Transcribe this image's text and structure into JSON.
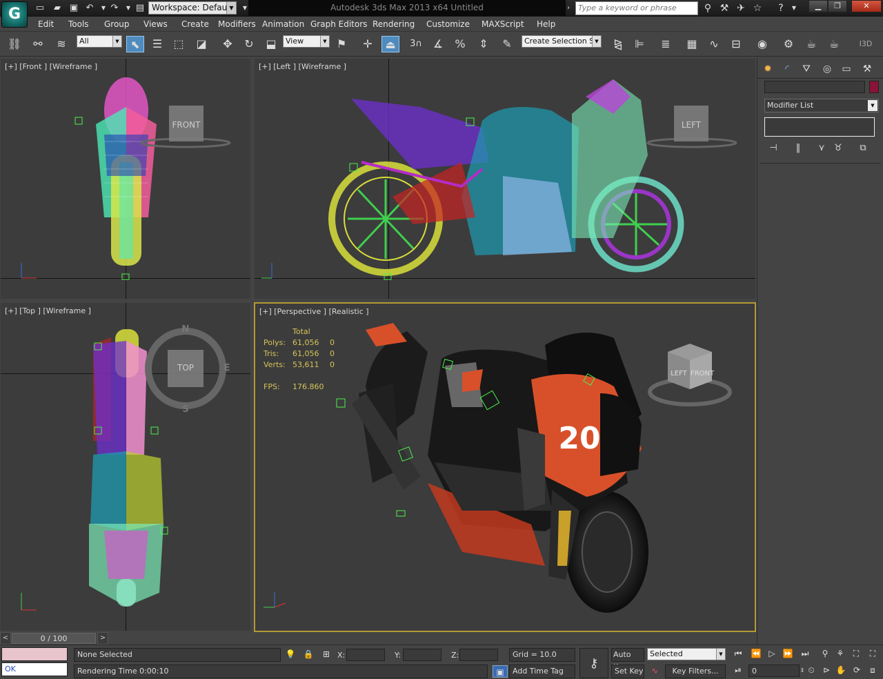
{
  "titlebar": {
    "workspace": "Workspace: Default",
    "title": "Autodesk 3ds Max  2013 x64      Untitled",
    "search_placeholder": "Type a keyword or phrase"
  },
  "menu": [
    "Edit",
    "Tools",
    "Group",
    "Views",
    "Create",
    "Modifiers",
    "Animation",
    "Graph Editors",
    "Rendering",
    "Customize",
    "MAXScript",
    "Help"
  ],
  "toolbar": {
    "filter": "All",
    "refcoord": "View",
    "selset": "Create Selection Se",
    "snap_num": "3",
    "label_3d": "I3D"
  },
  "viewports": {
    "front": "[+] [Front ] [Wireframe ]",
    "left": "[+] [Left ] [Wireframe ]",
    "top": "[+] [Top ] [Wireframe ]",
    "persp": "[+] [Perspective ] [Realistic ]",
    "viewcube_front": "FRONT",
    "viewcube_left": "LEFT",
    "viewcube_top": "TOP",
    "viewcube_persp_left": "LEFT",
    "viewcube_persp_front": "FRONT",
    "compass_n": "N",
    "compass_e": "E",
    "compass_s": "S",
    "race_number": "20"
  },
  "stats": {
    "header": "Total",
    "polys_label": "Polys:",
    "polys_total": "61,056",
    "polys_sel": "0",
    "tris_label": "Tris:",
    "tris_total": "61,056",
    "tris_sel": "0",
    "verts_label": "Verts:",
    "verts_total": "53,611",
    "verts_sel": "0",
    "fps_label": "FPS:",
    "fps_value": "176.860"
  },
  "command_panel": {
    "modifier_list": "Modifier List",
    "object_color": "#8a1338"
  },
  "timeslider": {
    "frame": "0 / 100",
    "prev": "<",
    "next": ">"
  },
  "status": {
    "listener_top": "",
    "listener_bottom": "OK",
    "selection": "None Selected",
    "prompt": "Rendering Time  0:00:10",
    "x_label": "X:",
    "y_label": "Y:",
    "z_label": "Z:",
    "grid": "Grid = 10.0",
    "add_time_tag": "Add Time Tag",
    "auto_key": "Auto Key",
    "set_key": "Set Key",
    "key_mode": "Selected",
    "key_filters": "Key Filters...",
    "current_frame": "0"
  }
}
